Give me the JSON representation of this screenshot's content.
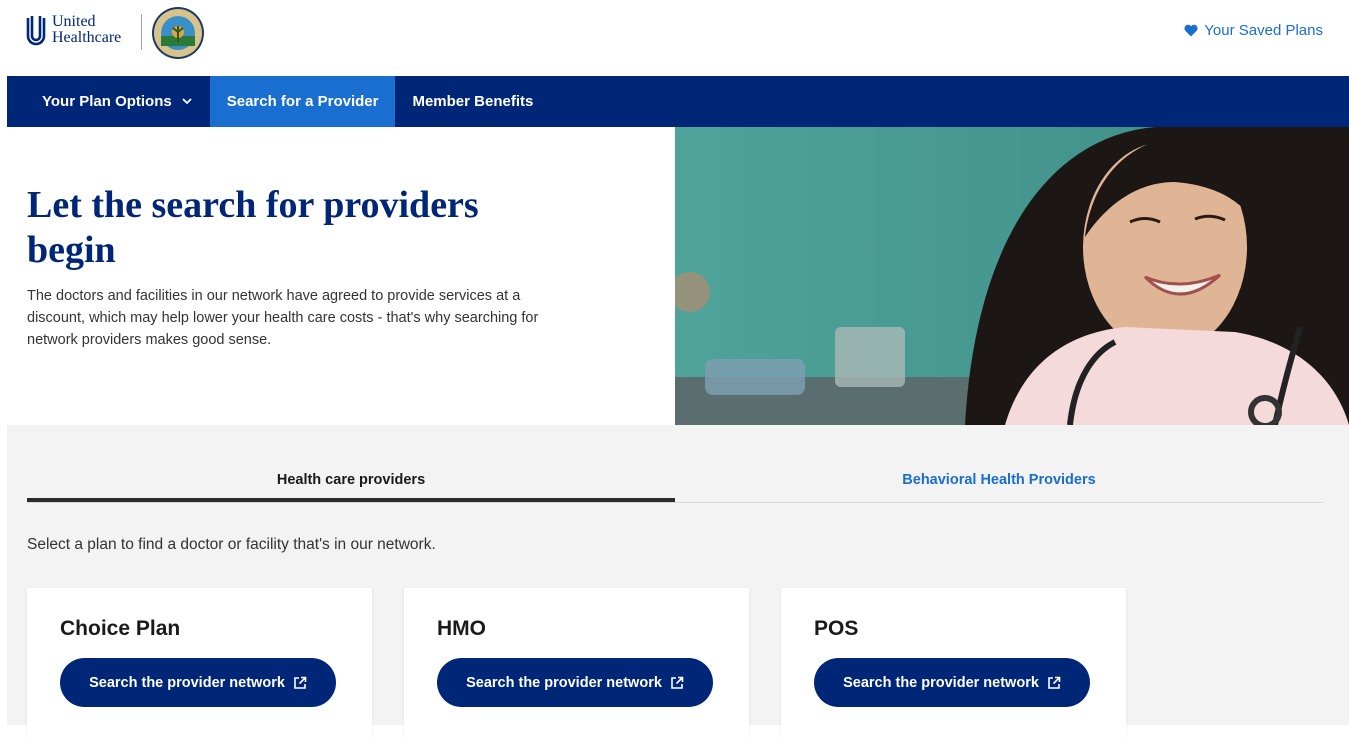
{
  "header": {
    "brand_line1": "United",
    "brand_line2": "Healthcare",
    "seal_label": "Palm Beach County Florida",
    "saved_plans_label": "Your Saved Plans"
  },
  "nav": {
    "items": [
      {
        "label": "Your Plan Options"
      },
      {
        "label": "Search for a Provider"
      },
      {
        "label": "Member Benefits"
      }
    ]
  },
  "hero": {
    "title": "Let the search for providers begin",
    "body": "The doctors and facilities in our network have agreed to provide services at a discount, which may help lower your health care costs - that's why searching for network providers makes good sense."
  },
  "tabs": [
    {
      "label": "Health care providers"
    },
    {
      "label": "Behavioral Health Providers"
    }
  ],
  "select_text": "Select a plan to find a doctor or facility that's in our network.",
  "plans": [
    {
      "title": "Choice Plan",
      "button": "Search the provider network"
    },
    {
      "title": "HMO",
      "button": "Search the provider network"
    },
    {
      "title": "POS",
      "button": "Search the provider network"
    }
  ],
  "colors": {
    "navy": "#002677",
    "accent_blue": "#196ECF",
    "panel_gray": "#f3f3f3"
  }
}
